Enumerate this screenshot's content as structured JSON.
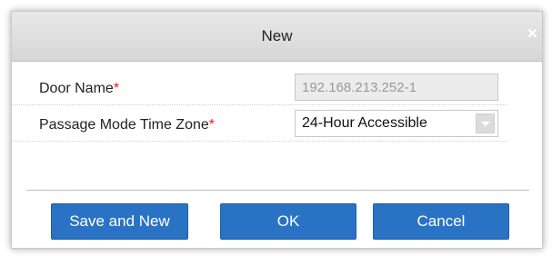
{
  "dialog": {
    "title": "New",
    "close_glyph": "×"
  },
  "form": {
    "door_name": {
      "label": "Door Name",
      "required_mark": "*",
      "value": "192.168.213.252-1",
      "disabled": true
    },
    "passage_mode_time_zone": {
      "label": "Passage Mode Time Zone",
      "required_mark": "*",
      "selected": "24-Hour Accessible"
    }
  },
  "buttons": {
    "save_and_new": "Save and New",
    "ok": "OK",
    "cancel": "Cancel"
  },
  "colors": {
    "primary_button": "#2a73c4",
    "required_asterisk": "#e02020",
    "title_bar": "#dcdcdc"
  },
  "icons": {
    "close": "close-icon",
    "dropdown": "chevron-down-icon"
  }
}
